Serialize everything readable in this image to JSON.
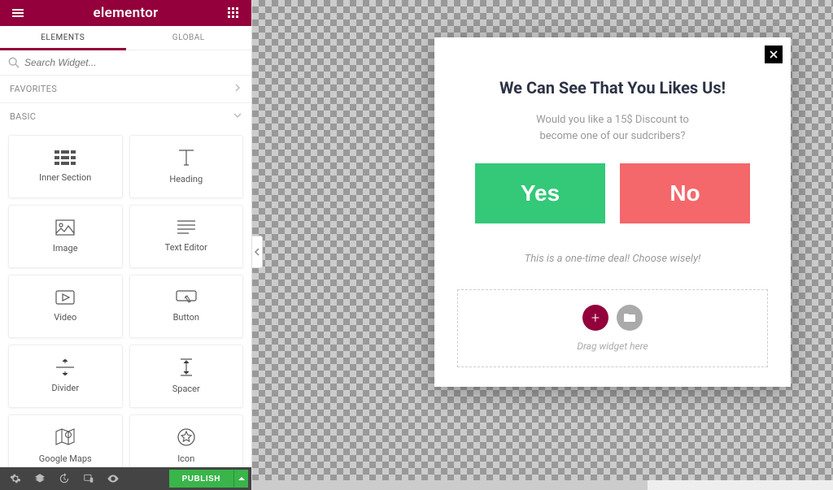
{
  "header": {
    "brand": "elementor"
  },
  "tabs": {
    "elements": "ELEMENTS",
    "global": "GLOBAL"
  },
  "search": {
    "placeholder": "Search Widget..."
  },
  "sections": {
    "favorites": "FAVORITES",
    "basic": "BASIC"
  },
  "widgets": [
    {
      "label": "Inner Section",
      "name": "inner-section",
      "icon": "columns-icon"
    },
    {
      "label": "Heading",
      "name": "heading",
      "icon": "heading-icon"
    },
    {
      "label": "Image",
      "name": "image",
      "icon": "image-icon"
    },
    {
      "label": "Text Editor",
      "name": "text-editor",
      "icon": "text-lines-icon"
    },
    {
      "label": "Video",
      "name": "video",
      "icon": "video-icon"
    },
    {
      "label": "Button",
      "name": "button",
      "icon": "button-icon"
    },
    {
      "label": "Divider",
      "name": "divider",
      "icon": "divider-icon"
    },
    {
      "label": "Spacer",
      "name": "spacer",
      "icon": "spacer-icon"
    },
    {
      "label": "Google Maps",
      "name": "google-maps",
      "icon": "map-pin-icon"
    },
    {
      "label": "Icon",
      "name": "icon",
      "icon": "star-icon"
    }
  ],
  "footer": {
    "publish": "PUBLISH"
  },
  "modal": {
    "title": "We Can See That You Likes Us!",
    "line1": "Would you like a 15$ Discount to",
    "line2": "become one of our sudcribers?",
    "yes": "Yes",
    "no": "No",
    "note": "This is a one-time deal! Choose wisely!",
    "drop_text": "Drag widget here",
    "plus": "+"
  }
}
